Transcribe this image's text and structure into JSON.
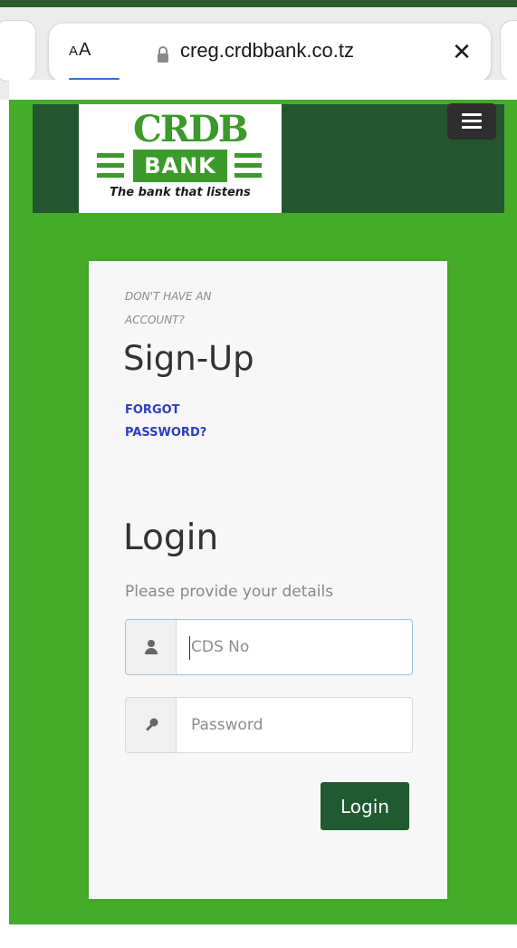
{
  "browser": {
    "reader_label_small": "A",
    "reader_label_large": "A",
    "url": "creg.crdbbank.co.tz",
    "close_glyph": "✕",
    "icons": [
      "lock-icon",
      "close-icon"
    ]
  },
  "header": {
    "logo_brand": "CRDB",
    "logo_bank": "BANK",
    "logo_tagline": "The bank that listens",
    "menu_icon": "hamburger-menu-icon"
  },
  "card": {
    "no_account_text": "DON'T HAVE AN ACCOUNT?",
    "signup_label": "Sign-Up",
    "forgot_label": "FORGOT PASSWORD?",
    "login_heading": "Login",
    "login_subtitle": "Please provide your details",
    "cds_placeholder": "CDS No",
    "cds_value": "",
    "cds_icon": "user-icon",
    "password_placeholder": "Password",
    "password_value": "",
    "password_icon": "key-icon",
    "login_button": "Login"
  },
  "colors": {
    "page_green": "#44ac29",
    "header_dark_green": "#23552e",
    "button_green": "#1f5a30",
    "link_blue": "#2c3fbf"
  }
}
